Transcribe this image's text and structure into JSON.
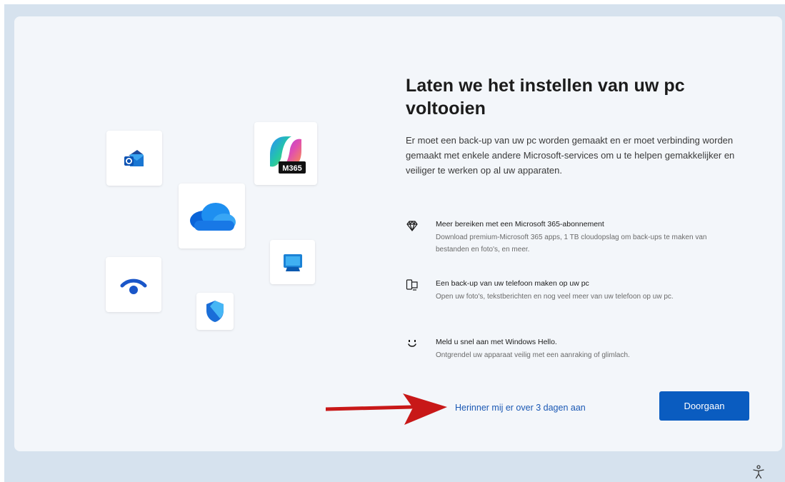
{
  "setup": {
    "title": "Laten we het instellen van uw pc voltooien",
    "description": "Er moet een back-up van uw pc worden gemaakt en er moet verbinding worden gemaakt met enkele andere Microsoft-services om u te helpen gemakkelijker en veiliger te werken op al uw apparaten.",
    "features": [
      {
        "icon": "diamond-icon",
        "heading": "Meer bereiken met een Microsoft 365-abonnement",
        "body": "Download premium-Microsoft 365 apps, 1 TB cloudopslag om back-ups te maken van bestanden en foto's, en meer."
      },
      {
        "icon": "phone-link-icon",
        "heading": "Een back-up van uw telefoon maken op uw pc",
        "body": "Open uw foto's, tekstberichten en nog veel meer van uw telefoon op uw pc."
      },
      {
        "icon": "smiley-icon",
        "heading": "Meld u snel aan met Windows Hello.",
        "body": "Ontgrendel uw apparaat veilig met een aanraking of glimlach."
      }
    ],
    "remind_link": "Herinner mij er over 3 dagen aan",
    "continue_button": "Doorgaan",
    "m365_badge": "M365"
  },
  "icons": {
    "apps": [
      "outlook-icon",
      "copilot-m365-icon",
      "onedrive-icon",
      "windows-pc-icon",
      "wifi-icon",
      "defender-shield-icon"
    ],
    "annotation": "red-arrow-icon",
    "accessibility": "accessibility-icon"
  },
  "colors": {
    "accent": "#0a5cc0",
    "link": "#1a58b4",
    "arrow": "#c81818",
    "background": "#d6e2ee",
    "card": "#f3f6fa"
  }
}
